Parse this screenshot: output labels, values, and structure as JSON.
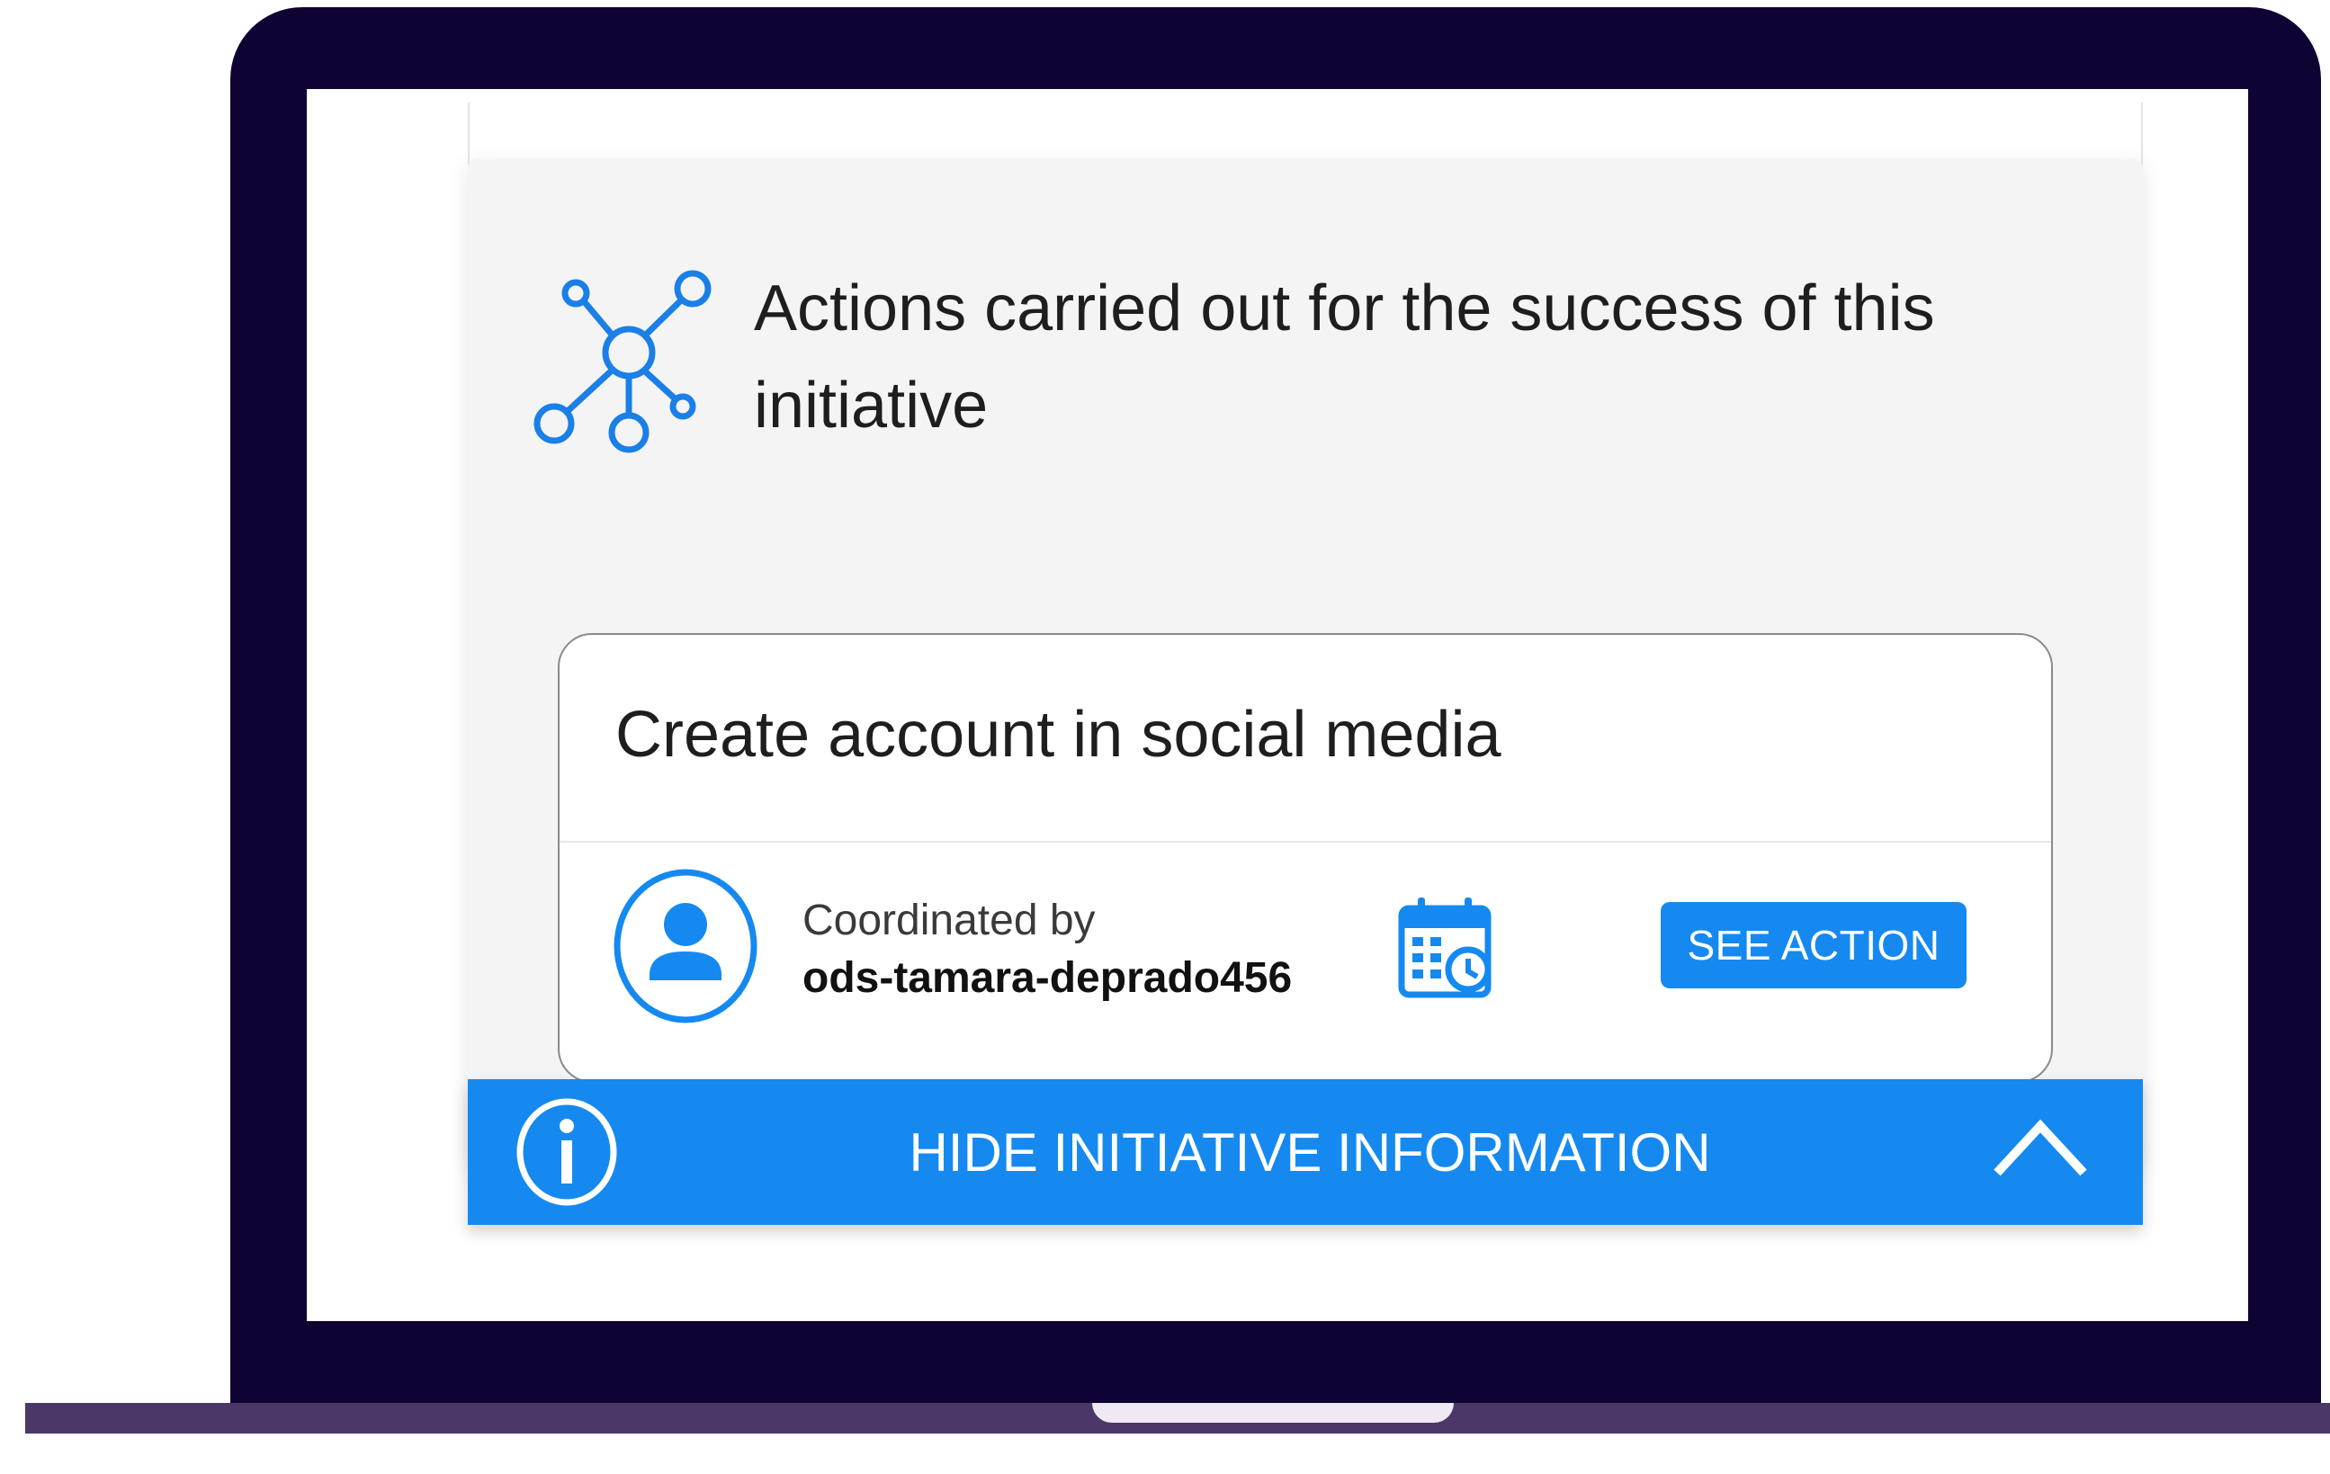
{
  "colors": {
    "accent": "#1589f0",
    "laptop_frame": "#0f0333",
    "laptop_base": "#4b3768",
    "panel_bg": "#f4f4f4"
  },
  "section": {
    "title": "Actions carried out for the success of this initiative",
    "icon": "network-nodes-icon"
  },
  "action_card": {
    "title": "Create account in social media",
    "coordinated_label": "Coordinated by",
    "coordinator": "ods-tamara-deprado456",
    "avatar_icon": "user-avatar-icon",
    "calendar_icon": "calendar-clock-icon",
    "button_label": "SEE ACTION"
  },
  "hide_bar": {
    "label": "HIDE INITIATIVE INFORMATION",
    "info_icon": "info-icon",
    "toggle_icon": "chevron-up-icon"
  }
}
